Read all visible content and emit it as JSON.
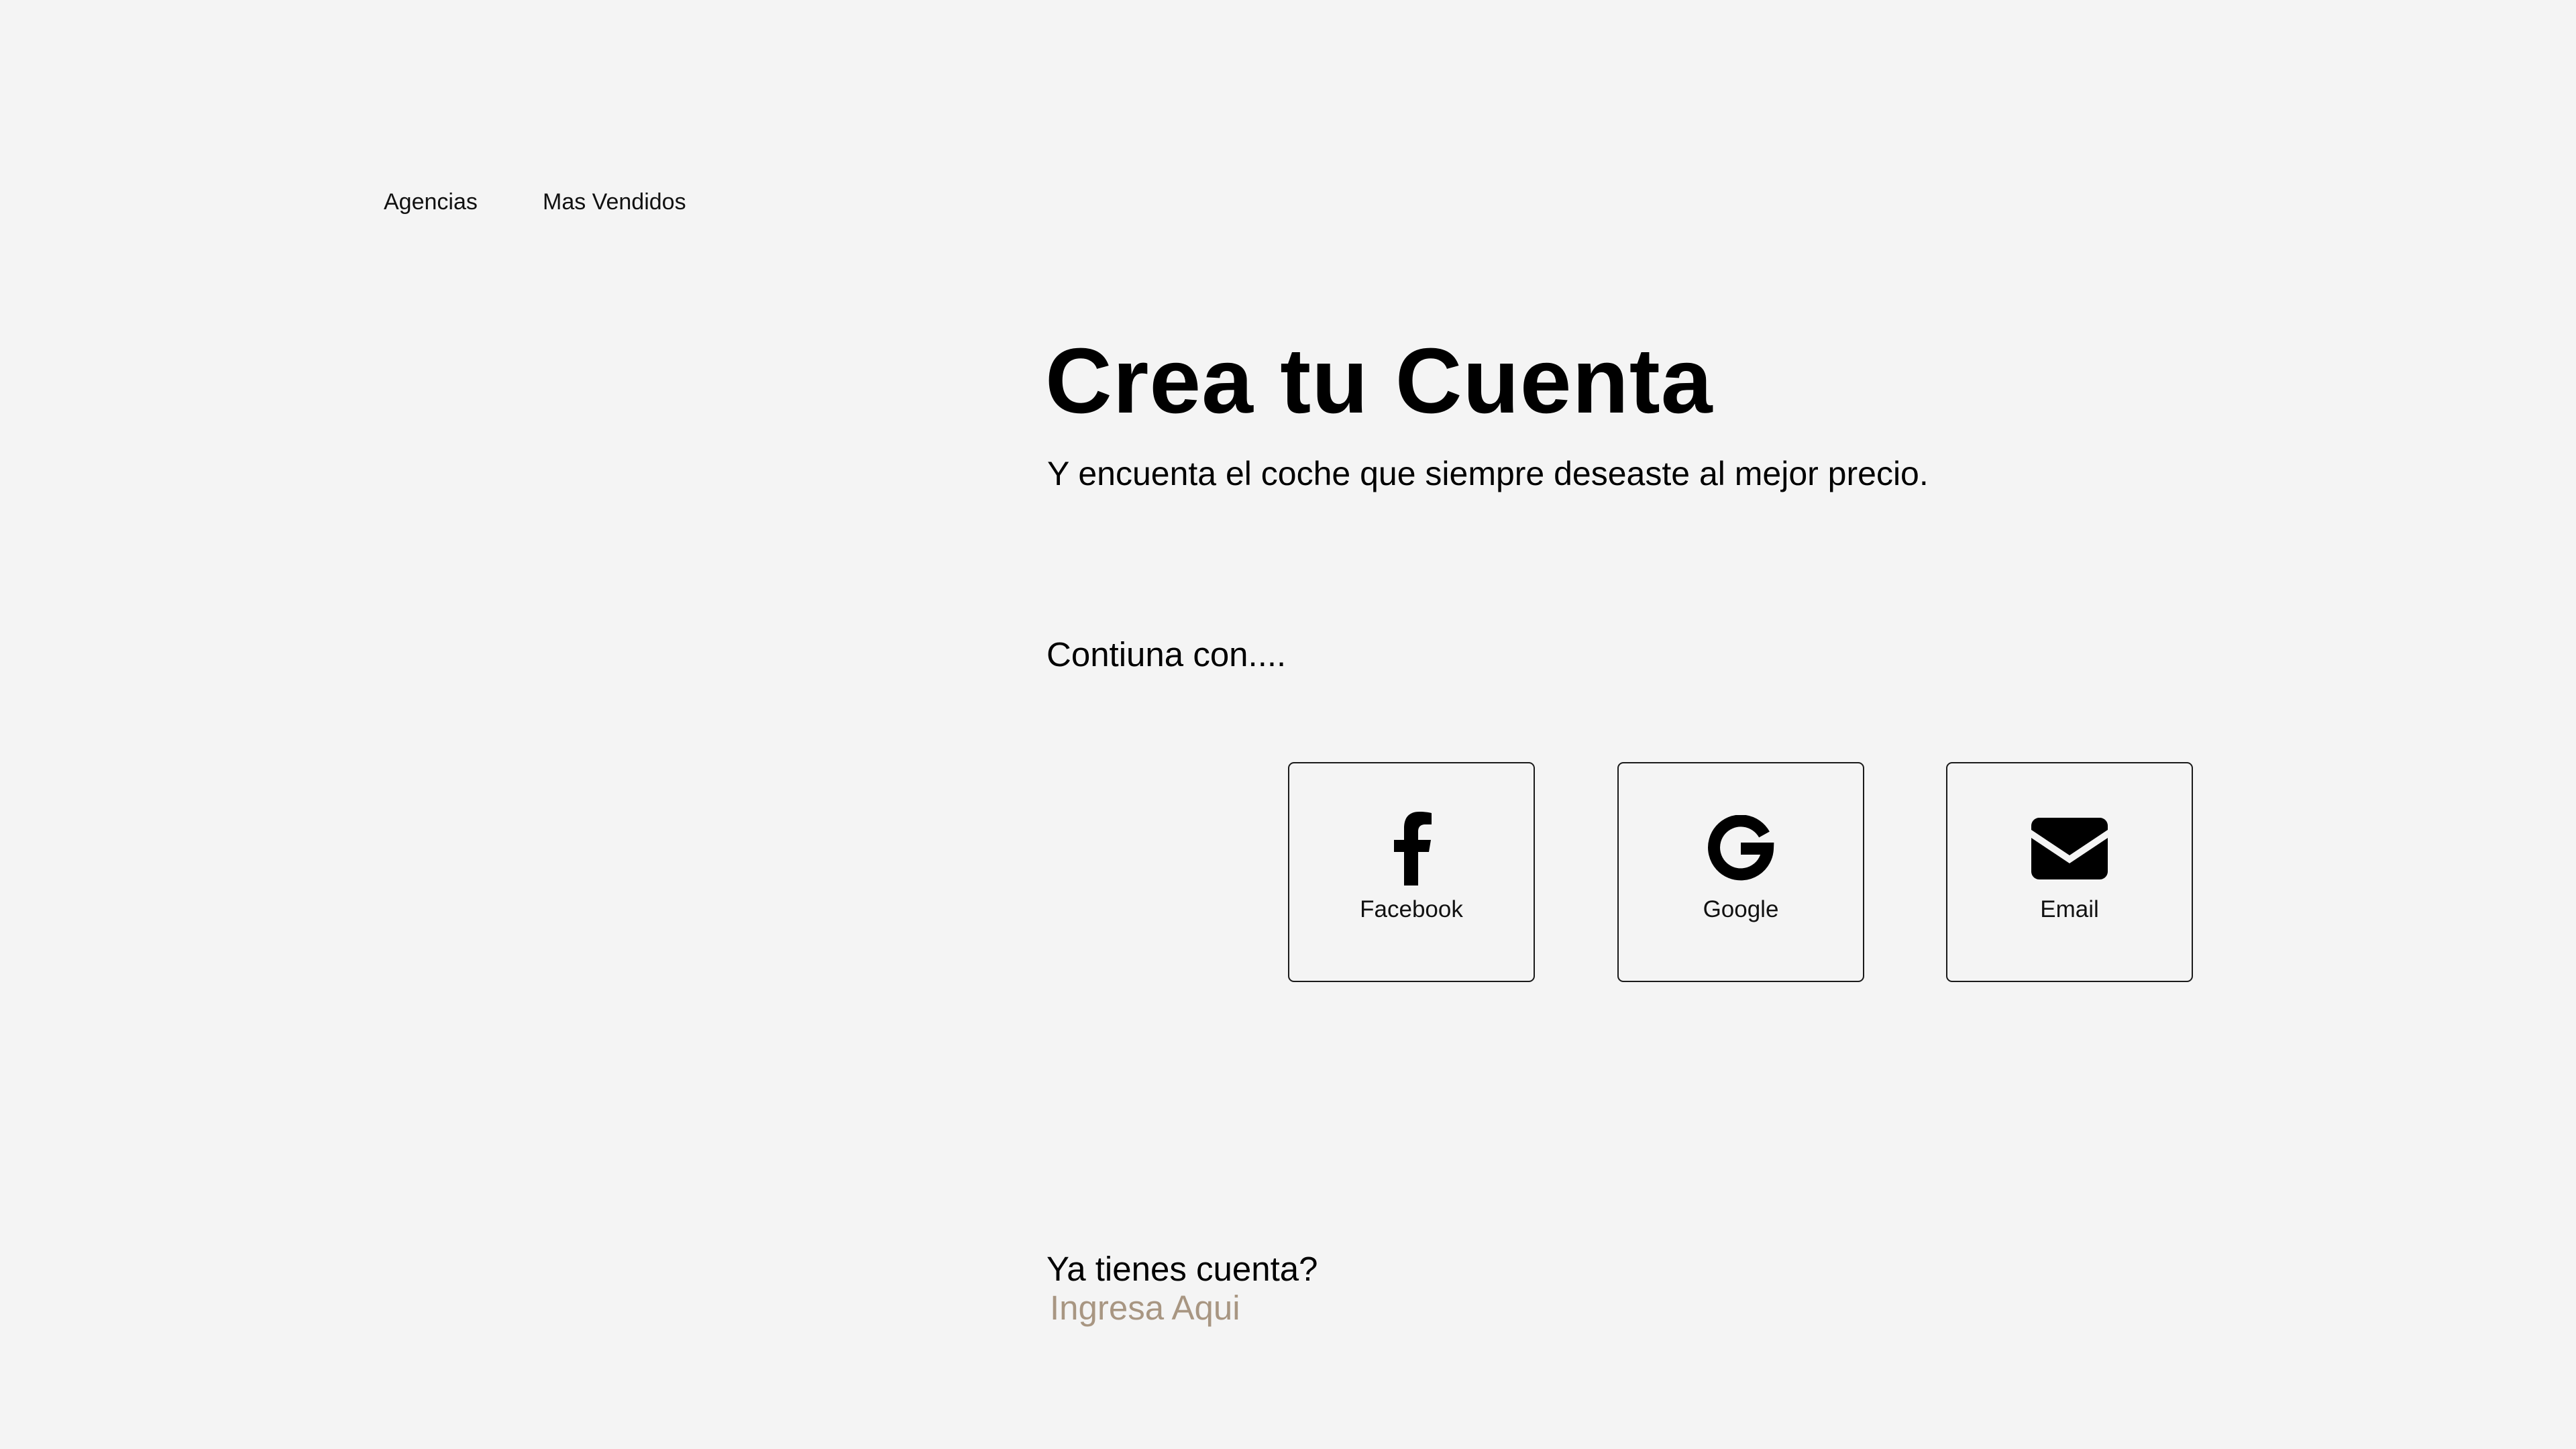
{
  "nav": {
    "items": [
      {
        "label": "Agencias"
      },
      {
        "label": "Mas Vendidos"
      }
    ]
  },
  "main": {
    "title": "Crea tu Cuenta",
    "subtitle": "Y encuenta el coche que siempre deseaste al mejor precio.",
    "continue_label": "Contiuna con....",
    "options": [
      {
        "label": "Facebook",
        "icon": "facebook-icon"
      },
      {
        "label": "Google",
        "icon": "google-icon"
      },
      {
        "label": "Email",
        "icon": "envelope-icon"
      }
    ]
  },
  "footer": {
    "question": "Ya tienes cuenta?",
    "login_link": "Ingresa Aqui"
  },
  "colors": {
    "background": "#f4f4f4",
    "text": "#000000",
    "link_accent": "#a89682",
    "button_border": "#1a1a1a"
  }
}
